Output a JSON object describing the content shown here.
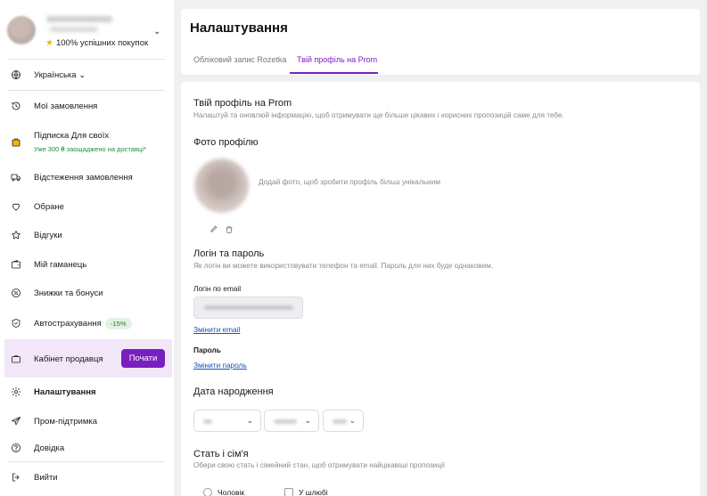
{
  "user": {
    "rating_text": "100% успішних покупок"
  },
  "sidebar": {
    "language": "Українська",
    "items": [
      {
        "label": "Мої замовлення"
      },
      {
        "label": "Підписка Для своїх",
        "sub": "Уже 300 ₴ заощаджено на доставці*"
      },
      {
        "label": "Відстеження замовлення"
      },
      {
        "label": "Обране"
      },
      {
        "label": "Відгуки"
      },
      {
        "label": "Мій гаманець"
      },
      {
        "label": "Знижки та бонуси"
      },
      {
        "label": "Автострахування",
        "badge": "-15%"
      },
      {
        "label": "Кабінет продавця",
        "button": "Почати"
      },
      {
        "label": "Налаштування"
      },
      {
        "label": "Пром-підтримка"
      },
      {
        "label": "Довідка"
      },
      {
        "label": "Вийти"
      }
    ]
  },
  "header": {
    "title": "Налаштування",
    "tabs": [
      {
        "label": "Обліковий запис Rozetka",
        "active": false
      },
      {
        "label": "Твій профіль на Prom",
        "active": true
      }
    ]
  },
  "profile": {
    "title": "Твій профіль на Prom",
    "subtitle": "Налаштуй та оновлюй інформацію, щоб отримувати ще більше цікавих і корисних пропозицій саме для тебе.",
    "photo_title": "Фото профілю",
    "photo_hint": "Додай фото, щоб зробити профіль більш унікальним",
    "login_title": "Логін та пароль",
    "login_subtitle": "Як логін ви можете використовувати телефон та email. Пароль для них буде однаковим.",
    "email_label": "Логін по email",
    "change_email": "Змінити email",
    "password_label": "Пароль",
    "change_password": "Змінити пароль",
    "birth_title": "Дата народження",
    "family_title": "Стать і сім'я",
    "family_subtitle": "Обери свою стать і сімейний стан, щоб отримувати найцікавіші пропозиції",
    "gender_male": "Чоловік",
    "married": "У шлюбі"
  },
  "colors": {
    "accent": "#7a1fbf",
    "link": "#1a52b8",
    "badge_green": "#1c7a32",
    "seller_bg": "#f1e7f9"
  }
}
